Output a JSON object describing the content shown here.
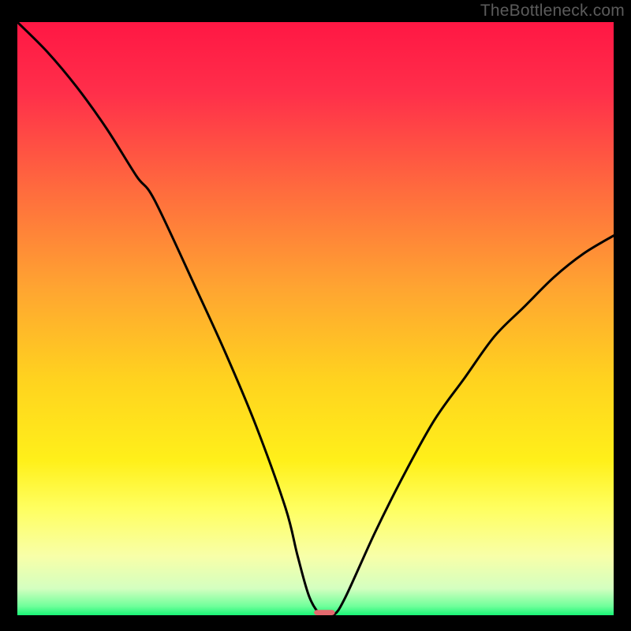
{
  "watermark": "TheBottleneck.com",
  "chart_data": {
    "type": "line",
    "title": "",
    "xlabel": "",
    "ylabel": "",
    "xlim": [
      0,
      100
    ],
    "ylim": [
      0,
      100
    ],
    "series": [
      {
        "name": "curve",
        "x": [
          0,
          5,
          10,
          15,
          20,
          23,
          30,
          35,
          40,
          45,
          47,
          49,
          51,
          53,
          55,
          60,
          65,
          70,
          75,
          80,
          85,
          90,
          95,
          100
        ],
        "values": [
          100,
          95,
          89,
          82,
          74,
          70,
          55,
          44,
          32,
          18,
          10,
          3,
          0,
          0,
          3,
          14,
          24,
          33,
          40,
          47,
          52,
          57,
          61,
          64
        ]
      }
    ],
    "marker": {
      "x": 51.5,
      "y_bottom": 0,
      "width_x": 3.5,
      "height_y": 0.9,
      "color": "#e46a6f"
    },
    "gradient_stops": [
      {
        "pos": 0.0,
        "color": "#ff1744"
      },
      {
        "pos": 0.12,
        "color": "#ff2f4a"
      },
      {
        "pos": 0.28,
        "color": "#ff6a3e"
      },
      {
        "pos": 0.45,
        "color": "#ffa531"
      },
      {
        "pos": 0.6,
        "color": "#ffd21f"
      },
      {
        "pos": 0.74,
        "color": "#fff01a"
      },
      {
        "pos": 0.82,
        "color": "#ffff60"
      },
      {
        "pos": 0.9,
        "color": "#f8ffa8"
      },
      {
        "pos": 0.955,
        "color": "#d4ffc0"
      },
      {
        "pos": 0.985,
        "color": "#6fff9a"
      },
      {
        "pos": 1.0,
        "color": "#18f576"
      }
    ],
    "curve_stroke": "#000000",
    "curve_width": 3
  }
}
